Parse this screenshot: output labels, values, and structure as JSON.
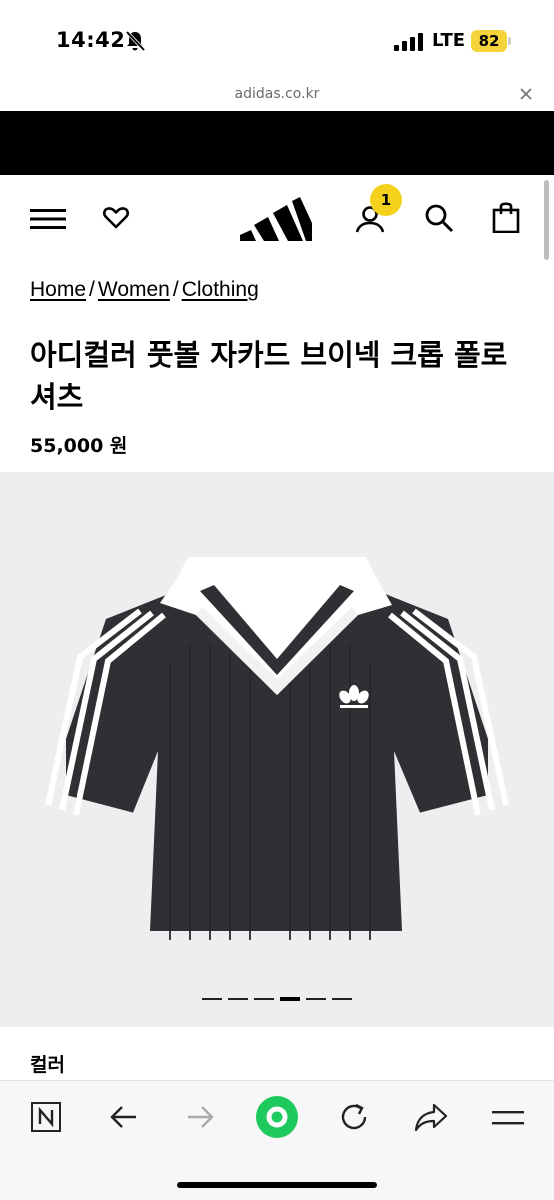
{
  "status_bar": {
    "time": "14:42",
    "network": "LTE",
    "battery": "82",
    "icons": [
      "bell-slash-icon",
      "signal-icon",
      "battery-icon"
    ]
  },
  "browser": {
    "url": "adidas.co.kr",
    "toolbar_icons": [
      "naver-n-icon",
      "back-arrow-icon",
      "forward-arrow-icon",
      "green-circle-icon",
      "reload-icon",
      "share-icon",
      "menu-icon"
    ],
    "accent_color": "#1ec95d"
  },
  "header": {
    "cart_count": "1",
    "badge_color": "#f4d21c",
    "icons": [
      "hamburger-menu-icon",
      "heart-icon",
      "adidas-logo",
      "account-icon",
      "search-icon",
      "shopping-bag-icon"
    ]
  },
  "breadcrumb": {
    "items": [
      "Home",
      "Women",
      "Clothing"
    ],
    "separator": "/"
  },
  "product": {
    "title": "아디컬러 풋볼 자카드 브이넥 크롭 폴로 셔츠",
    "price": "55,000 원",
    "image_bg": "#eceeef"
  },
  "carousel": {
    "count": 6,
    "active_index": 3
  },
  "section": {
    "color_label": "컬러"
  }
}
